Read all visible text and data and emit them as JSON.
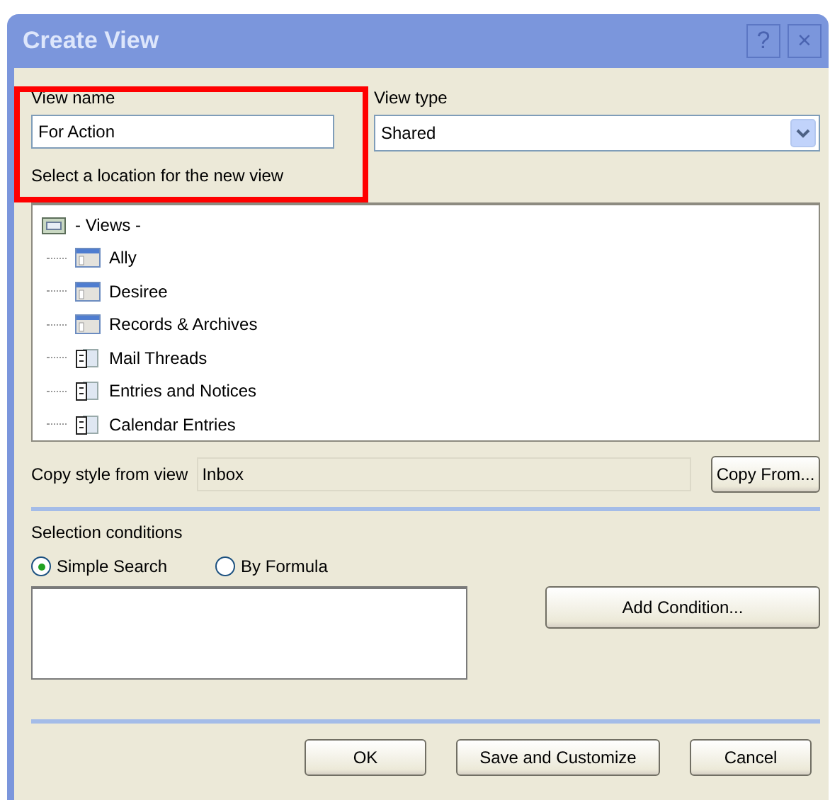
{
  "window": {
    "title": "Create View",
    "buttons": [
      "?",
      "×"
    ]
  },
  "view_name": {
    "label": "View name",
    "value": "For Action"
  },
  "view_type": {
    "label": "View type",
    "value": "Shared"
  },
  "location": {
    "label": "Select a location for the new view",
    "tree": [
      {
        "label": "- Views -",
        "kind": "root",
        "children": [
          {
            "label": "Ally",
            "kind": "view"
          },
          {
            "label": "Desiree",
            "kind": "view"
          },
          {
            "label": "Records & Archives",
            "kind": "view"
          },
          {
            "label": "Mail Threads",
            "kind": "folder"
          },
          {
            "label": "Entries and Notices",
            "kind": "folder"
          },
          {
            "label": "Calendar Entries",
            "kind": "folder"
          }
        ]
      }
    ]
  },
  "copy_style": {
    "label": "Copy style from view",
    "value": "Inbox",
    "button": "Copy From..."
  },
  "selection": {
    "label": "Selection conditions",
    "options": [
      {
        "label": "Simple Search",
        "selected": true
      },
      {
        "label": "By Formula",
        "selected": false
      }
    ],
    "button": "Add Condition..."
  },
  "buttons": [
    "OK",
    "Save and Customize",
    "Cancel"
  ]
}
